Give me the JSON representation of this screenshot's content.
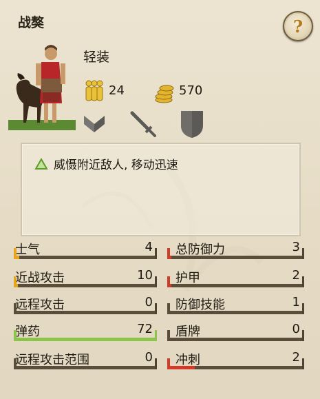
{
  "title": "战獒",
  "help_button": {
    "label": "?"
  },
  "unit": {
    "class": "轻装",
    "soldiers": "24",
    "cost": "570",
    "icons": [
      "chevron-icon",
      "sword-icon",
      "shield-icon"
    ]
  },
  "description": {
    "trait_text": "威慑附近敌人, 移动迅速",
    "trait_icon": "triangle-outline-icon"
  },
  "stats_left": [
    {
      "label": "士气",
      "value": "4",
      "level": 0.04,
      "color": "#e6a51f"
    },
    {
      "label": "近战攻击",
      "value": "10",
      "level": 0.03,
      "color": "#e6a51f"
    },
    {
      "label": "远程攻击",
      "value": "0",
      "level": 0.0,
      "color": "#5a4e3b"
    },
    {
      "label": "弹药",
      "value": "72",
      "level": 1.0,
      "color": "#8cc34a"
    },
    {
      "label": "远程攻击范围",
      "value": "0",
      "level": 0.0,
      "color": "#5a4e3b"
    }
  ],
  "stats_right": [
    {
      "label": "总防御力",
      "value": "3",
      "level": 0.03,
      "color": "#d23a2a"
    },
    {
      "label": "护甲",
      "value": "2",
      "level": 0.03,
      "color": "#d23a2a"
    },
    {
      "label": "防御技能",
      "value": "1",
      "level": 0.0,
      "color": "#5a4e3b"
    },
    {
      "label": "盾牌",
      "value": "0",
      "level": 0.0,
      "color": "#5a4e3b"
    },
    {
      "label": "冲刺",
      "value": "2",
      "level": 0.2,
      "color": "#d23a2a"
    }
  ],
  "colors": {
    "orange": "#e6a51f",
    "green": "#8cc34a",
    "red": "#d23a2a",
    "bar_base": "#5a4e3b"
  }
}
